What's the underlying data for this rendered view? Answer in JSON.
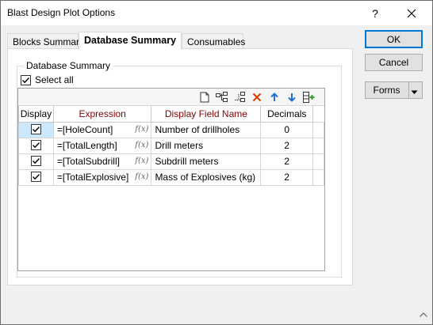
{
  "window": {
    "title": "Blast Design Plot Options",
    "help_glyph": "?"
  },
  "tabs": [
    {
      "label": "Blocks Summary"
    },
    {
      "label": "Database Summary"
    },
    {
      "label": "Consumables"
    }
  ],
  "group": {
    "label": "Database Summary"
  },
  "select_all": {
    "label": "Select all",
    "checked": true
  },
  "grid": {
    "columns": [
      "Display",
      "Expression",
      "Display Field Name",
      "Decimals"
    ],
    "fx_glyph": "f(x)",
    "rows": [
      {
        "display": true,
        "expression": "=[HoleCount]",
        "field_name": "Number of drillholes",
        "decimals": "0"
      },
      {
        "display": true,
        "expression": "=[TotalLength]",
        "field_name": "Drill meters",
        "decimals": "2"
      },
      {
        "display": true,
        "expression": "=[TotalSubdrill]",
        "field_name": "Subdrill meters",
        "decimals": "2"
      },
      {
        "display": true,
        "expression": "=[TotalExplosive]",
        "field_name": "Mass of Explosives (kg)",
        "decimals": "2"
      }
    ]
  },
  "buttons": {
    "ok": "OK",
    "cancel": "Cancel",
    "forms": "Forms"
  },
  "colors": {
    "accent": "#0078d7",
    "header_red": "#8b0000",
    "selection": "#cce8ff",
    "delete_red": "#d83b01",
    "arrow_blue": "#1e6fd9"
  }
}
